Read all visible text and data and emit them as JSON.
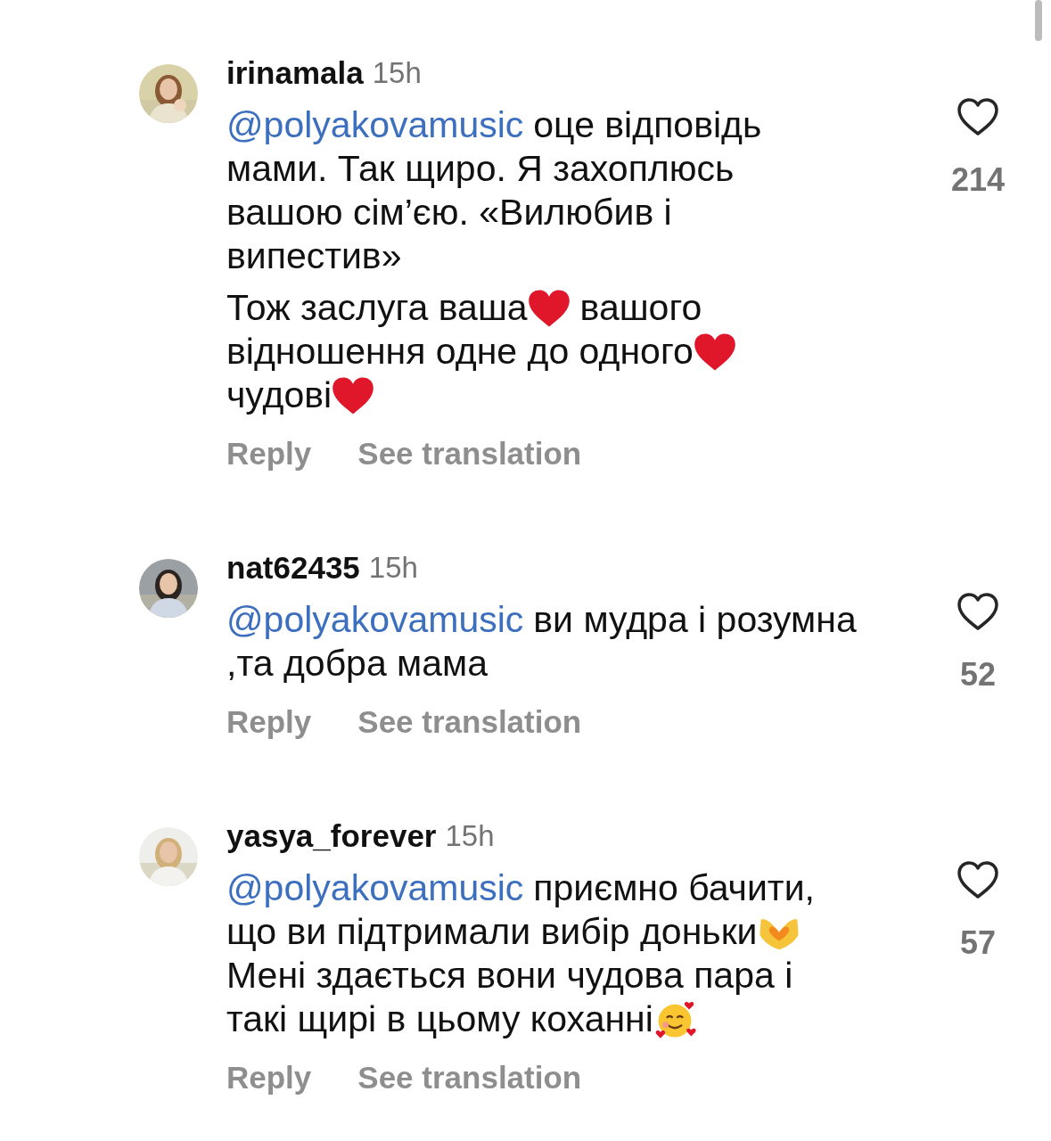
{
  "comments": [
    {
      "username": "irinamala",
      "time": "15h",
      "likes": "214",
      "paragraphs": [
        [
          [
            {
              "kind": "mention",
              "text": "@polyakovamusic"
            },
            {
              "kind": "text",
              "text": "оце відповідь"
            }
          ],
          [
            {
              "kind": "text",
              "text": "мами. Так щиро. Я захоплюсь"
            }
          ],
          [
            {
              "kind": "text",
              "text": "вашою сім’єю. «Вилюбив і"
            }
          ],
          [
            {
              "kind": "text",
              "text": "випестив»"
            }
          ]
        ],
        [
          [
            {
              "kind": "text",
              "text": "Тож заслуга ваша"
            },
            {
              "kind": "heart"
            },
            {
              "kind": "text",
              "text": "вашого"
            }
          ],
          [
            {
              "kind": "text",
              "text": "відношення одне до одного"
            },
            {
              "kind": "heart"
            }
          ],
          [
            {
              "kind": "text",
              "text": "чудові"
            },
            {
              "kind": "heart"
            }
          ]
        ]
      ],
      "actions": [
        "Reply",
        "See translation"
      ]
    },
    {
      "username": "nat62435",
      "time": "15h",
      "likes": "52",
      "paragraphs": [
        [
          [
            {
              "kind": "mention",
              "text": "@polyakovamusic"
            },
            {
              "kind": "text",
              "text": "ви мудра і розумна"
            }
          ],
          [
            {
              "kind": "text",
              "text": ",та добра мама"
            }
          ]
        ]
      ],
      "actions": [
        "Reply",
        "See translation"
      ]
    },
    {
      "username": "yasya_forever",
      "time": "15h",
      "likes": "57",
      "paragraphs": [
        [
          [
            {
              "kind": "mention",
              "text": "@polyakovamusic"
            },
            {
              "kind": "text",
              "text": "приємно бачити,"
            }
          ],
          [
            {
              "kind": "text",
              "text": "що ви підтримали вибір доньки"
            },
            {
              "kind": "hands"
            }
          ],
          [
            {
              "kind": "text",
              "text": "Мені здається вони чудова пара і"
            }
          ],
          [
            {
              "kind": "text",
              "text": "такі щирі в цьому коханні"
            },
            {
              "kind": "smile"
            }
          ]
        ]
      ],
      "actions": [
        "Reply",
        "See translation"
      ]
    }
  ]
}
